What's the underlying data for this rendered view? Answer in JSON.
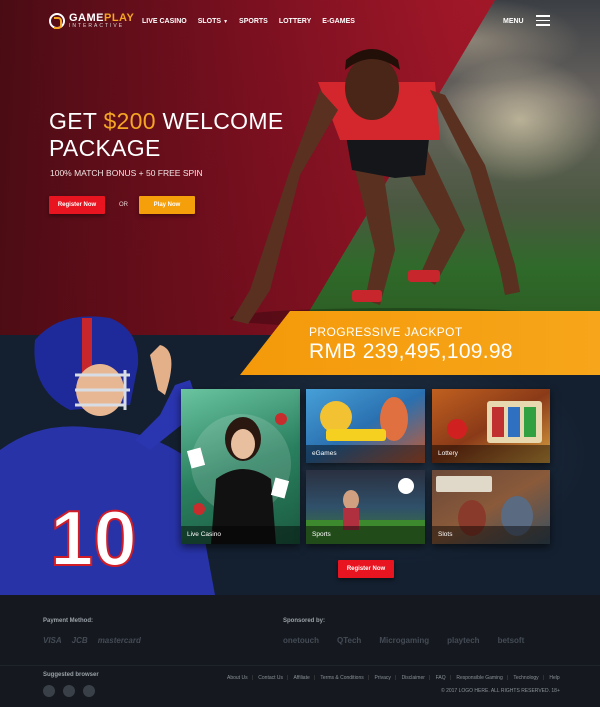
{
  "brand": {
    "name_part1": "GAME",
    "name_part2": "PLAY",
    "tagline": "INTERACTIVE"
  },
  "nav": {
    "links": [
      "LIVE CASINO",
      "SLOTS",
      "SPORTS",
      "LOTTERY",
      "E-GAMES"
    ],
    "menu_label": "MENU"
  },
  "hero": {
    "headline_prefix": "GET ",
    "headline_amount": "$200",
    "headline_suffix": " WELCOME PACKAGE",
    "subline": "100% MATCH BONUS + 50 FREE SPIN",
    "register_label": "Register Now",
    "or_label": "OR",
    "play_label": "Play Now"
  },
  "jackpot": {
    "title": "PROGRESSIVE JACKPOT",
    "amount": "RMB 239,495,109.98"
  },
  "games": {
    "tiles": [
      "Live Casino",
      "eGames",
      "Lottery",
      "Sports",
      "Slots"
    ],
    "register_label": "Register Now"
  },
  "footer": {
    "payment_heading": "Payment Method:",
    "payment_logos": [
      "VISA",
      "JCB",
      "mastercard"
    ],
    "sponsor_heading": "Sponsored by:",
    "sponsor_logos": [
      "onetouch",
      "QTech",
      "Microgaming",
      "playtech",
      "betsoft"
    ],
    "browser_heading": "Suggested browser",
    "browsers": [
      "chrome-icon",
      "firefox-icon",
      "edge-icon"
    ],
    "links": [
      "About Us",
      "Contact Us",
      "Affiliate",
      "Terms & Conditions",
      "Privacy",
      "Disclaimer",
      "FAQ",
      "Responsible Gaming",
      "Technology",
      "Help"
    ],
    "copyright": "© 2017 LOGO HERE. ALL RIGHTS RESERVED. 18+"
  },
  "colors": {
    "accent_orange": "#f5a623",
    "button_red": "#e8141f",
    "hero_red": "#a5182a"
  }
}
